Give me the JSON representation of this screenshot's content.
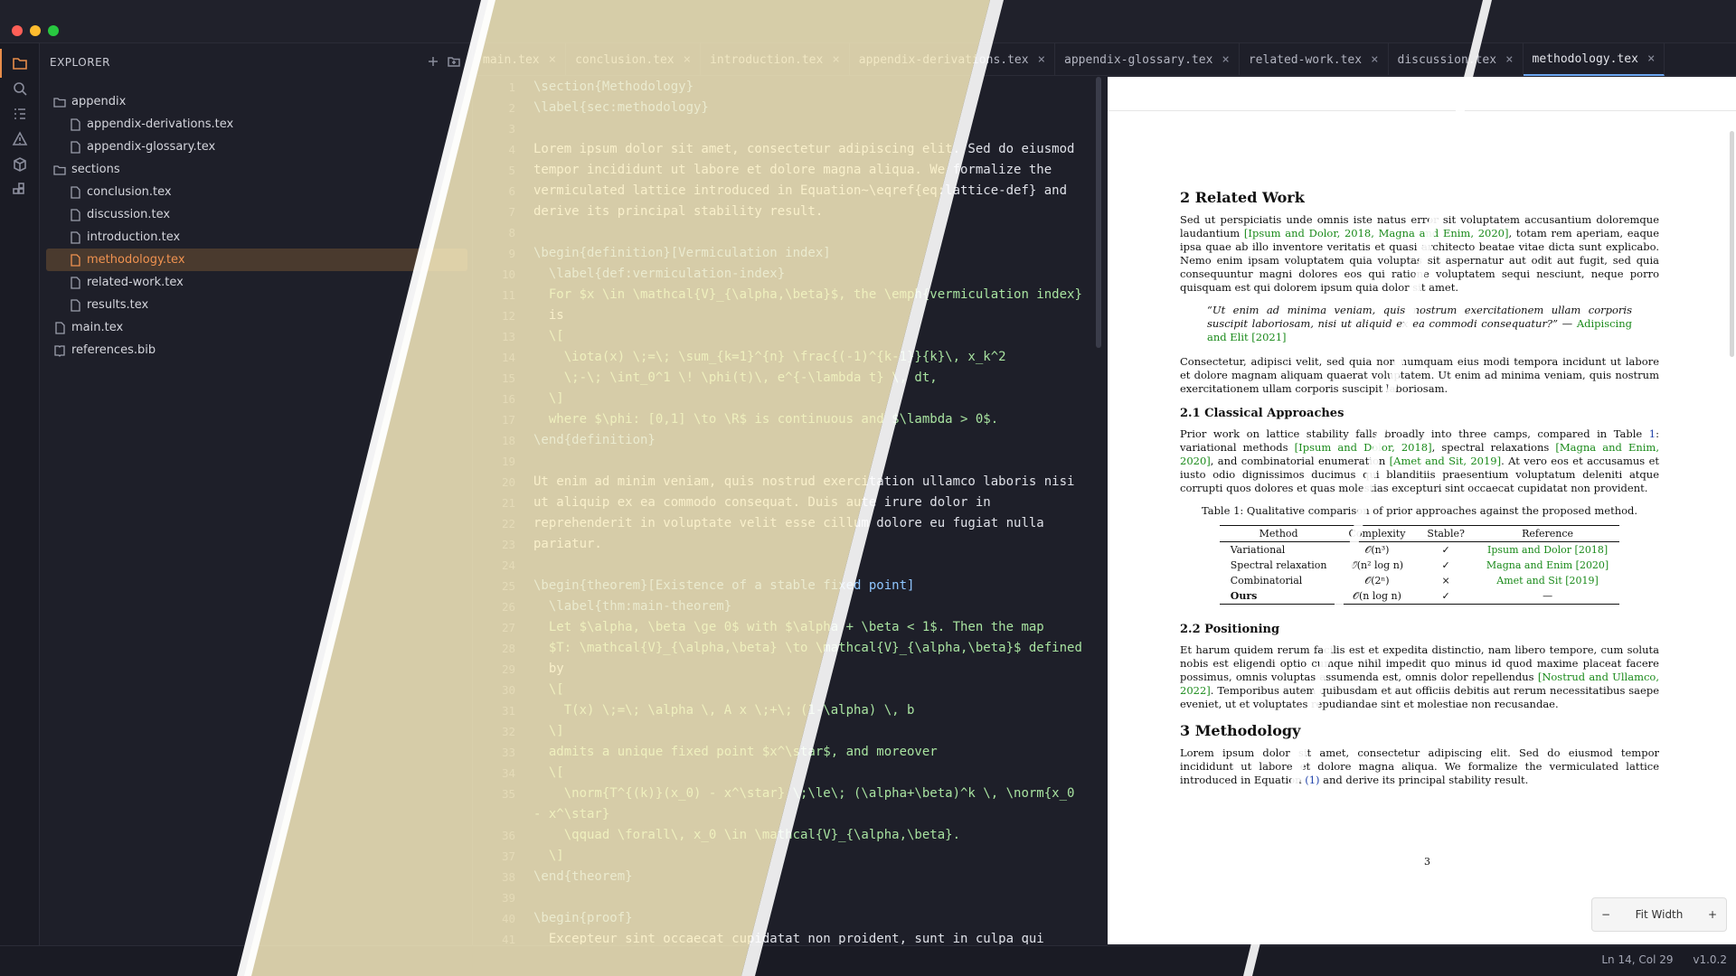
{
  "sidebar": {
    "title": "EXPLORER",
    "tree": [
      {
        "label": "appendix",
        "kind": "folder",
        "depth": 0
      },
      {
        "label": "appendix-derivations.tex",
        "kind": "file",
        "depth": 1
      },
      {
        "label": "appendix-glossary.tex",
        "kind": "file",
        "depth": 1
      },
      {
        "label": "sections",
        "kind": "folder",
        "depth": 0
      },
      {
        "label": "conclusion.tex",
        "kind": "file",
        "depth": 1
      },
      {
        "label": "discussion.tex",
        "kind": "file",
        "depth": 1
      },
      {
        "label": "introduction.tex",
        "kind": "file",
        "depth": 1
      },
      {
        "label": "methodology.tex",
        "kind": "file",
        "depth": 1,
        "selected": true
      },
      {
        "label": "related-work.tex",
        "kind": "file",
        "depth": 1
      },
      {
        "label": "results.tex",
        "kind": "file",
        "depth": 1
      },
      {
        "label": "main.tex",
        "kind": "file",
        "depth": 0
      },
      {
        "label": "references.bib",
        "kind": "bib",
        "depth": 0
      }
    ]
  },
  "tabs": [
    {
      "label": "main.tex"
    },
    {
      "label": "conclusion.tex"
    },
    {
      "label": "introduction.tex"
    },
    {
      "label": "appendix-derivations.tex"
    },
    {
      "label": "appendix-glossary.tex"
    },
    {
      "label": "related-work.tex"
    },
    {
      "label": "discussion.tex"
    },
    {
      "label": "methodology.tex",
      "active": true
    }
  ],
  "tab_close": "×",
  "editor": {
    "lines": [
      "\\section{Methodology}",
      "\\label{sec:methodology}",
      "",
      "Lorem ipsum dolor sit amet, consectetur adipiscing elit. Sed do eiusmod",
      "tempor incididunt ut labore et dolore magna aliqua. We formalize the",
      "vermiculated lattice introduced in Equation~\\eqref{eq:lattice-def} and",
      "derive its principal stability result.",
      "",
      "\\begin{definition}[Vermiculation index]",
      "  \\label{def:vermiculation-index}",
      "  For $x \\in \\mathcal{V}_{\\alpha,\\beta}$, the \\emph{vermiculation index}",
      "  is",
      "  \\[",
      "    \\iota(x) \\;=\\; \\sum_{k=1}^{n} \\frac{(-1)^{k-1}}{k}\\, x_k^2",
      "    \\;-\\; \\int_0^1 \\! \\phi(t)\\, e^{-\\lambda t} \\, dt,",
      "  \\]",
      "  where $\\phi: [0,1] \\to \\R$ is continuous and $\\lambda > 0$.",
      "\\end{definition}",
      "",
      "Ut enim ad minim veniam, quis nostrud exercitation ullamco laboris nisi",
      "ut aliquip ex ea commodo consequat. Duis aute irure dolor in",
      "reprehenderit in voluptate velit esse cillum dolore eu fugiat nulla",
      "pariatur.",
      "",
      "\\begin{theorem}[Existence of a stable fixed point]",
      "  \\label{thm:main-theorem}",
      "  Let $\\alpha, \\beta \\ge 0$ with $\\alpha + \\beta < 1$. Then the map",
      "  $T: \\mathcal{V}_{\\alpha,\\beta} \\to \\mathcal{V}_{\\alpha,\\beta}$ defined",
      "  by",
      "  \\[",
      "    T(x) \\;=\\; \\alpha \\, A x \\;+\\; (1-\\alpha) \\, b",
      "  \\]",
      "  admits a unique fixed point $x^\\star$, and moreover",
      "  \\[",
      "    \\norm{T^{(k)}(x_0) - x^\\star} \\;\\le\\; (\\alpha+\\beta)^k \\, \\norm{x_0",
      "- x^\\star}",
      "    \\qquad \\forall\\, x_0 \\in \\mathcal{V}_{\\alpha,\\beta}.",
      "  \\]",
      "\\end{theorem}",
      "",
      "\\begin{proof}",
      "  Excepteur sint occaecat cupidatat non proident, sunt in culpa qui"
    ],
    "numbers": [
      "1",
      "2",
      "3",
      "4",
      "5",
      "6",
      "7",
      "8",
      "9",
      "10",
      "11",
      "12",
      "13",
      "14",
      "15",
      "16",
      "17",
      "18",
      "19",
      "20",
      "21",
      "22",
      "23",
      "24",
      "25",
      "26",
      "27",
      "28",
      "29",
      "30",
      "31",
      "32",
      "33",
      "34",
      "35",
      "",
      "36",
      "37",
      "38",
      "39",
      "40",
      "41"
    ]
  },
  "preview": {
    "sec2_title": "2   Related Work",
    "sec2_p1a": "Sed ut perspiciatis unde omnis iste natus error sit voluptatem accusantium doloremque laudantium",
    "sec2_p1_cite": "[Ipsum and Dolor, 2018, Magna and Enim, 2020]",
    "sec2_p1b": ", totam rem aperiam, eaque ipsa quae ab illo inventore veritatis et quasi architecto beatae vitae dicta sunt explicabo. Nemo enim ipsam voluptatem quia voluptas sit aspernatur aut odit aut fugit, sed quia consequuntur magni dolores eos qui ratione voluptatem sequi nesciunt, neque porro quisquam est qui dolorem ipsum quia dolor sit amet.",
    "quote_text": "“Ut enim ad minima veniam, quis nostrum exercitationem ullam corporis suscipit laboriosam, nisi ut aliquid ex ea commodi consequatur?” — ",
    "quote_cite": "Adipiscing and Elit [2021]",
    "sec2_p2": "Consectetur, adipisci velit, sed quia non numquam eius modi tempora incidunt ut labore et dolore magnam aliquam quaerat voluptatem. Ut enim ad minima veniam, quis nostrum exercitationem ullam corporis suscipit laboriosam.",
    "sec21_title": "2.1   Classical Approaches",
    "sec21_a": "Prior work on lattice stability falls broadly into three camps, compared in Table ",
    "sec21_tref": "1",
    "sec21_b": ": variational methods ",
    "sec21_c1": "[Ipsum and Dolor, 2018]",
    "sec21_c": ", spectral relaxations ",
    "sec21_c2": "[Magna and Enim, 2020]",
    "sec21_d": ", and combinatorial enumeration ",
    "sec21_c3": "[Amet and Sit, 2019]",
    "sec21_e": ". At vero eos et accusamus et iusto odio dignissimos ducimus qui blanditiis praesentium voluptatum deleniti atque corrupti quos dolores et quas molestias excepturi sint occaecat cupidatat non provident.",
    "table_caption": "Table 1: Qualitative comparison of prior approaches against the proposed method.",
    "table_headers": [
      "Method",
      "Complexity",
      "Stable?",
      "Reference"
    ],
    "table_rows": [
      [
        "Variational",
        "𝒪(n³)",
        "✓",
        "Ipsum and Dolor [2018]"
      ],
      [
        "Spectral relaxation",
        "𝒪(n² log n)",
        "✓",
        "Magna and Enim [2020]"
      ],
      [
        "Combinatorial",
        "𝒪(2ⁿ)",
        "×",
        "Amet and Sit [2019]"
      ],
      [
        "Ours",
        "𝒪(n log n)",
        "✓",
        "—"
      ]
    ],
    "sec22_title": "2.2   Positioning",
    "sec22_a": "Et harum quidem rerum facilis est et expedita distinctio, nam libero tempore, cum soluta nobis est eligendi optio cumque nihil impedit quo minus id quod maxime placeat facere possimus, omnis voluptas assumenda est, omnis dolor repellendus ",
    "sec22_cite": "[Nostrud and Ullamco, 2022]",
    "sec22_b": ". Temporibus autem quibusdam et aut officiis debitis aut rerum necessitatibus saepe eveniet, ut et voluptates repudiandae sint et molestiae non recusandae.",
    "sec3_title": "3   Methodology",
    "sec3_a": "Lorem ipsum dolor sit amet, consectetur adipiscing elit. Sed do eiusmod tempor incididunt ut labore et dolore magna aliqua. We formalize the vermiculated lattice introduced in Equation ",
    "sec3_ref": "(1)",
    "sec3_b": " and derive its principal stability result.",
    "page_number": "3",
    "zoom_minus": "−",
    "zoom_label": "Fit Width",
    "zoom_plus": "+"
  },
  "status": {
    "position": "Ln 14, Col 29",
    "version": "v1.0.2"
  },
  "colors": {
    "accent": "#e88d4a",
    "selected_bg": "#4a3a2e",
    "cite": "#1a8a1a",
    "tab_active": "#6ea8f2"
  }
}
